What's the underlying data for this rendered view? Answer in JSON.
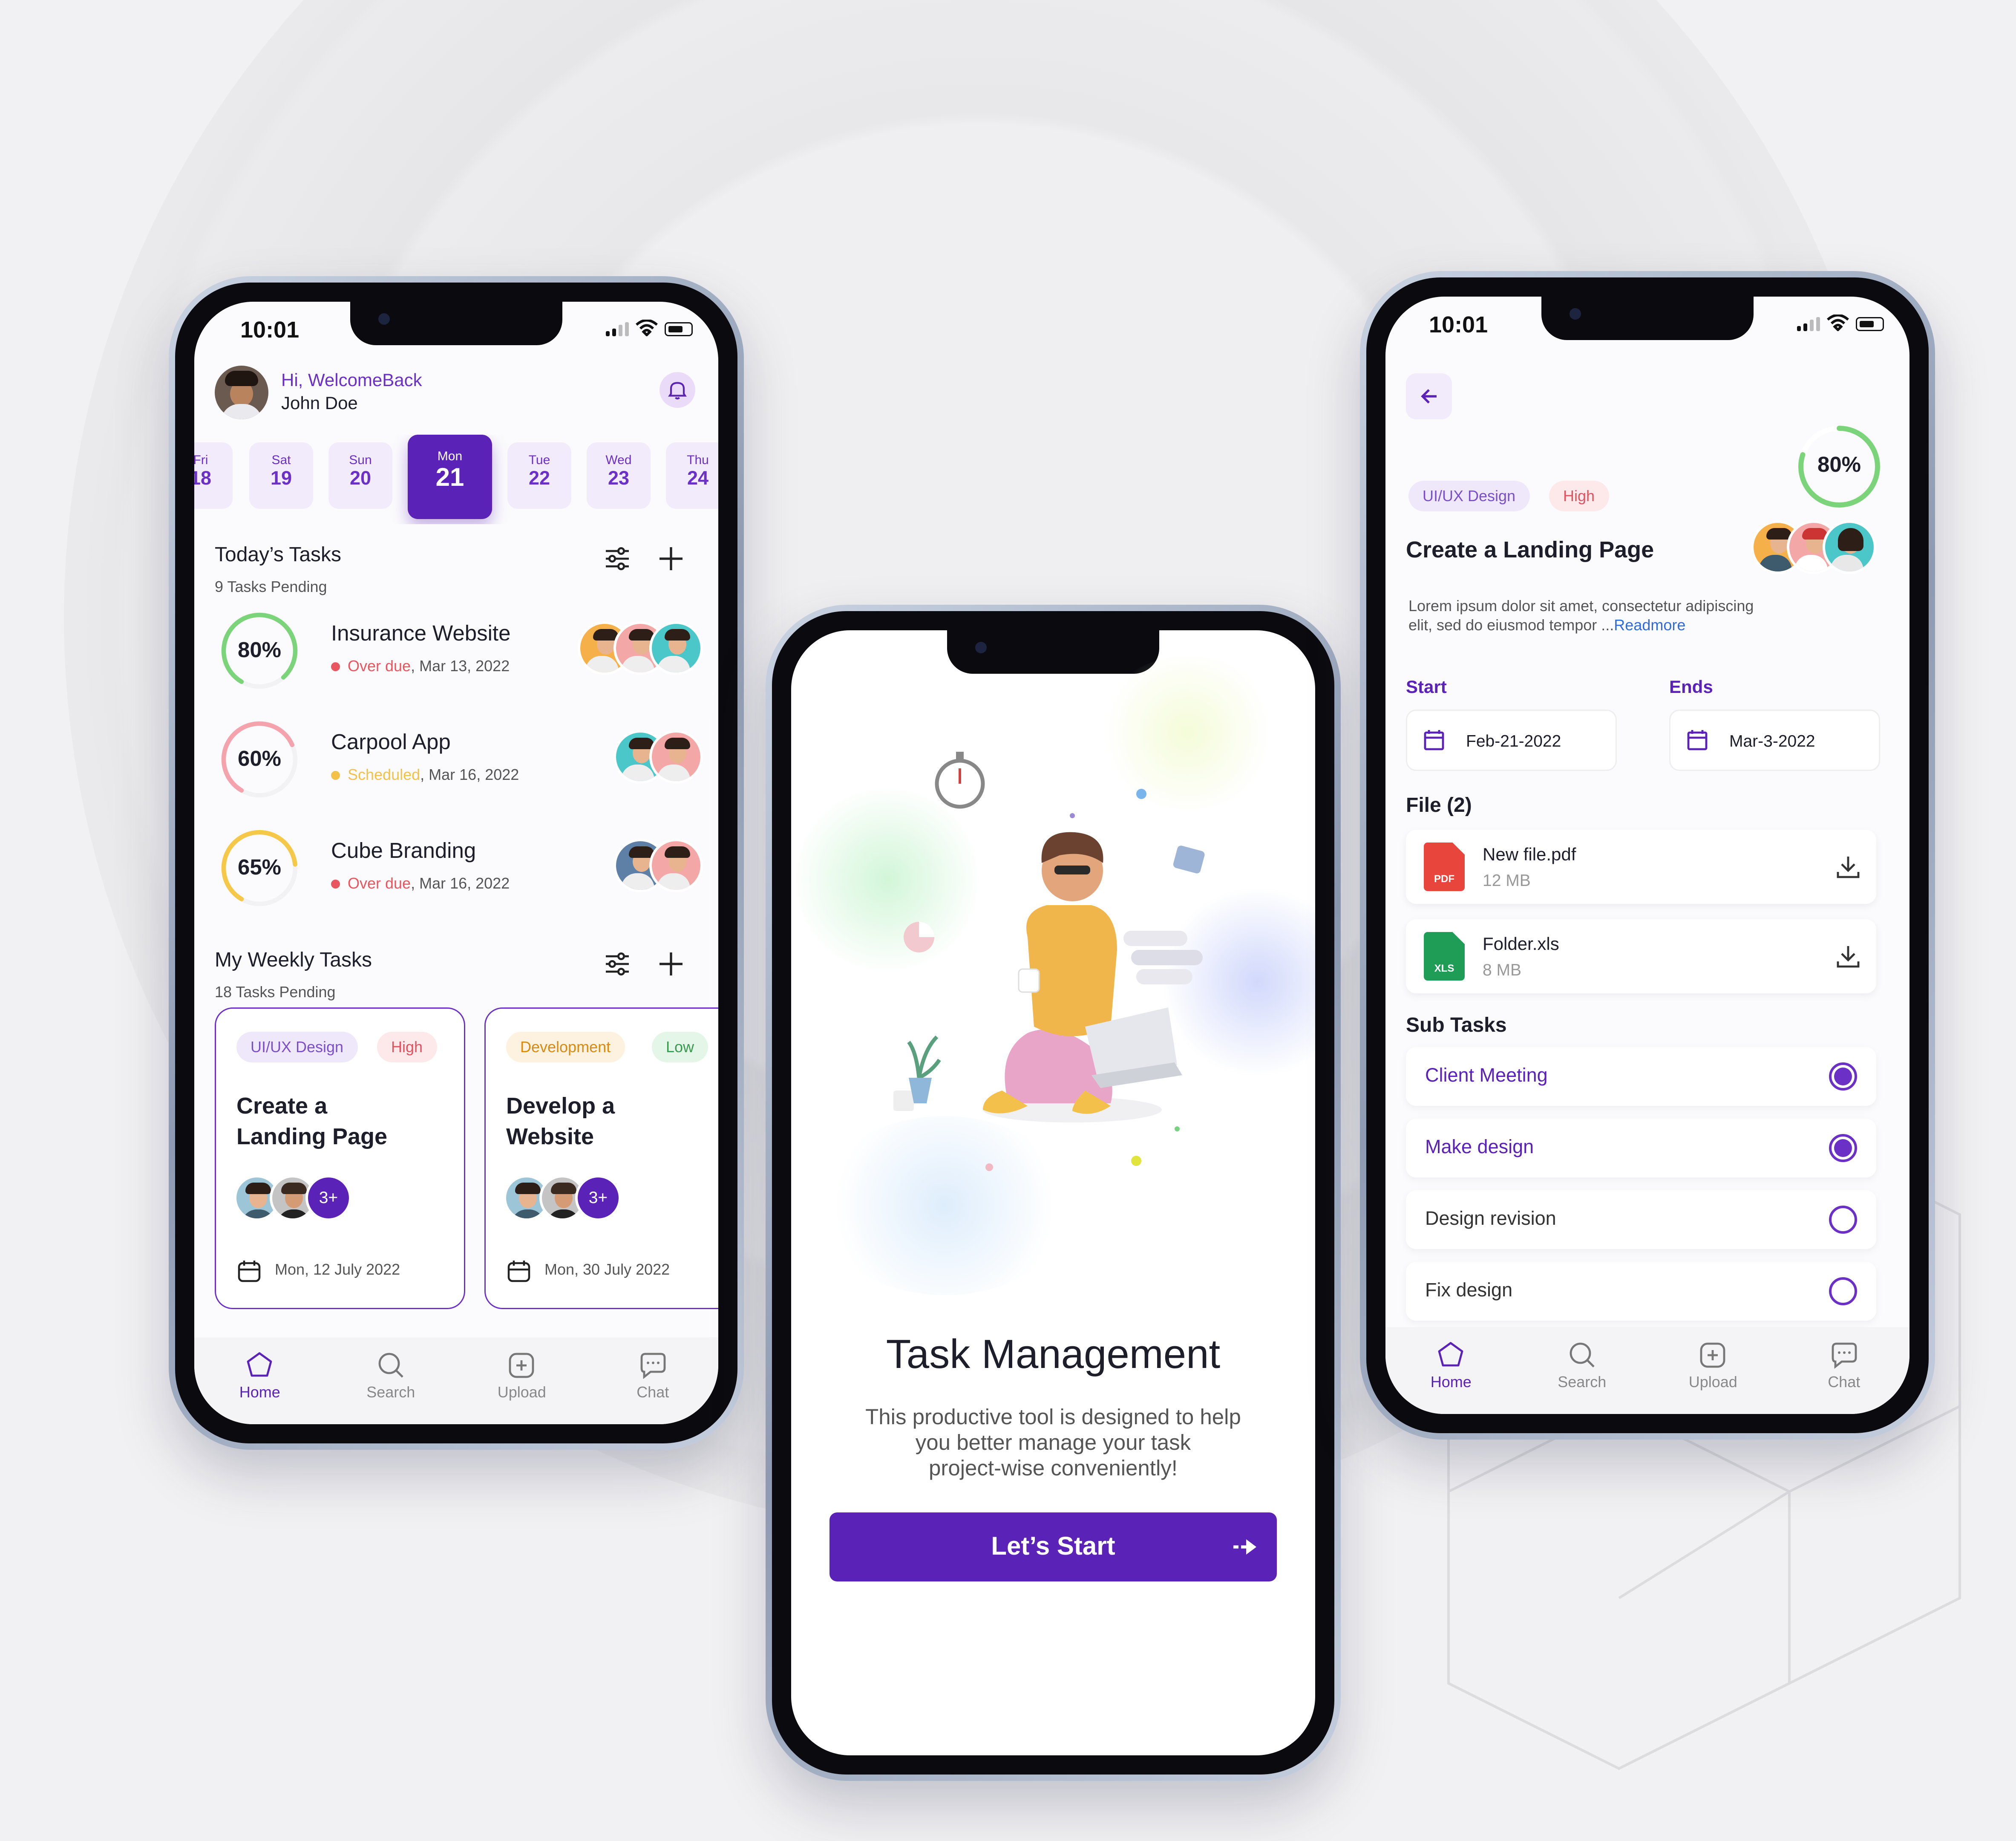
{
  "home": {
    "time": "10:01",
    "greeting": "Hi, WelcomeBack",
    "user_name": "John Doe",
    "dates": [
      {
        "day": "Fri",
        "num": "18"
      },
      {
        "day": "Sat",
        "num": "19"
      },
      {
        "day": "Sun",
        "num": "20"
      },
      {
        "day": "Mon",
        "num": "21"
      },
      {
        "day": "Tue",
        "num": "22"
      },
      {
        "day": "Wed",
        "num": "23"
      },
      {
        "day": "Thu",
        "num": "24"
      }
    ],
    "today": {
      "title": "Today’s Tasks",
      "pending": "9 Tasks Pending"
    },
    "tasks": [
      {
        "name": "Insurance Website",
        "percent": "80%",
        "progress": 0.8,
        "status": "Over due",
        "date": ", Mar 13, 2022",
        "ring_color": "#7cd47a",
        "status_color": "#e8565f"
      },
      {
        "name": "Carpool App",
        "percent": "60%",
        "progress": 0.6,
        "status": "Scheduled",
        "date": ", Mar 16, 2022",
        "ring_color": "#f4a3ad",
        "status_color": "#f2c14b"
      },
      {
        "name": "Cube Branding",
        "percent": "65%",
        "progress": 0.65,
        "status": "Over due",
        "date": ", Mar 16, 2022",
        "ring_color": "#f6c84a",
        "status_color": "#e8565f"
      }
    ],
    "weekly": {
      "title": "My Weekly Tasks",
      "pending": "18 Tasks Pending"
    },
    "cards": [
      {
        "tag1": "UI/UX Design",
        "tag2": "High",
        "title_line1": "Create a",
        "title_line2": "Landing Page",
        "more": "3+",
        "date": "Mon, 12 July 2022"
      },
      {
        "tag1": "Development",
        "tag2": "Low",
        "title_line1": "Develop a",
        "title_line2": "Website",
        "more": "3+",
        "date": "Mon, 30 July 2022"
      }
    ]
  },
  "nav": {
    "home": "Home",
    "search": "Search",
    "upload": "Upload",
    "chat": "Chat"
  },
  "onboarding": {
    "title": "Task Management",
    "description_line1": "This productive tool is designed to help",
    "description_line2": "you better manage your task",
    "description_line3": "project-wise conveniently!",
    "cta": "Let’s Start"
  },
  "detail": {
    "time": "10:01",
    "progress": 0.8,
    "progress_label": "80%",
    "tag1": "UI/UX Design",
    "tag2": "High",
    "title": "Create a Landing Page",
    "description_line1": "Lorem ipsum dolor sit amet, consectetur adipiscing",
    "description_line2": "elit, sed do eiusmod tempor",
    "ellipsis": " ...",
    "readmore": "Readmore",
    "start_label": "Start",
    "start_date": "Feb-21-2022",
    "end_label": "Ends",
    "end_date": "Mar-3-2022",
    "files_title": "File (2)",
    "files": [
      {
        "name": "New file.pdf",
        "size": "12 MB",
        "type": "PDF",
        "color": "#e8453c"
      },
      {
        "name": "Folder.xls",
        "size": "8 MB",
        "type": "XLS",
        "color": "#1f9d57"
      }
    ],
    "subtasks_title": "Sub Tasks",
    "subtasks": [
      {
        "label": "Client Meeting",
        "done": true
      },
      {
        "label": "Make design",
        "done": true
      },
      {
        "label": "Design revision",
        "done": false
      },
      {
        "label": "Fix design",
        "done": false
      }
    ]
  },
  "colors": {
    "primary": "#5b22b8",
    "accent_light": "#efe8fb"
  }
}
